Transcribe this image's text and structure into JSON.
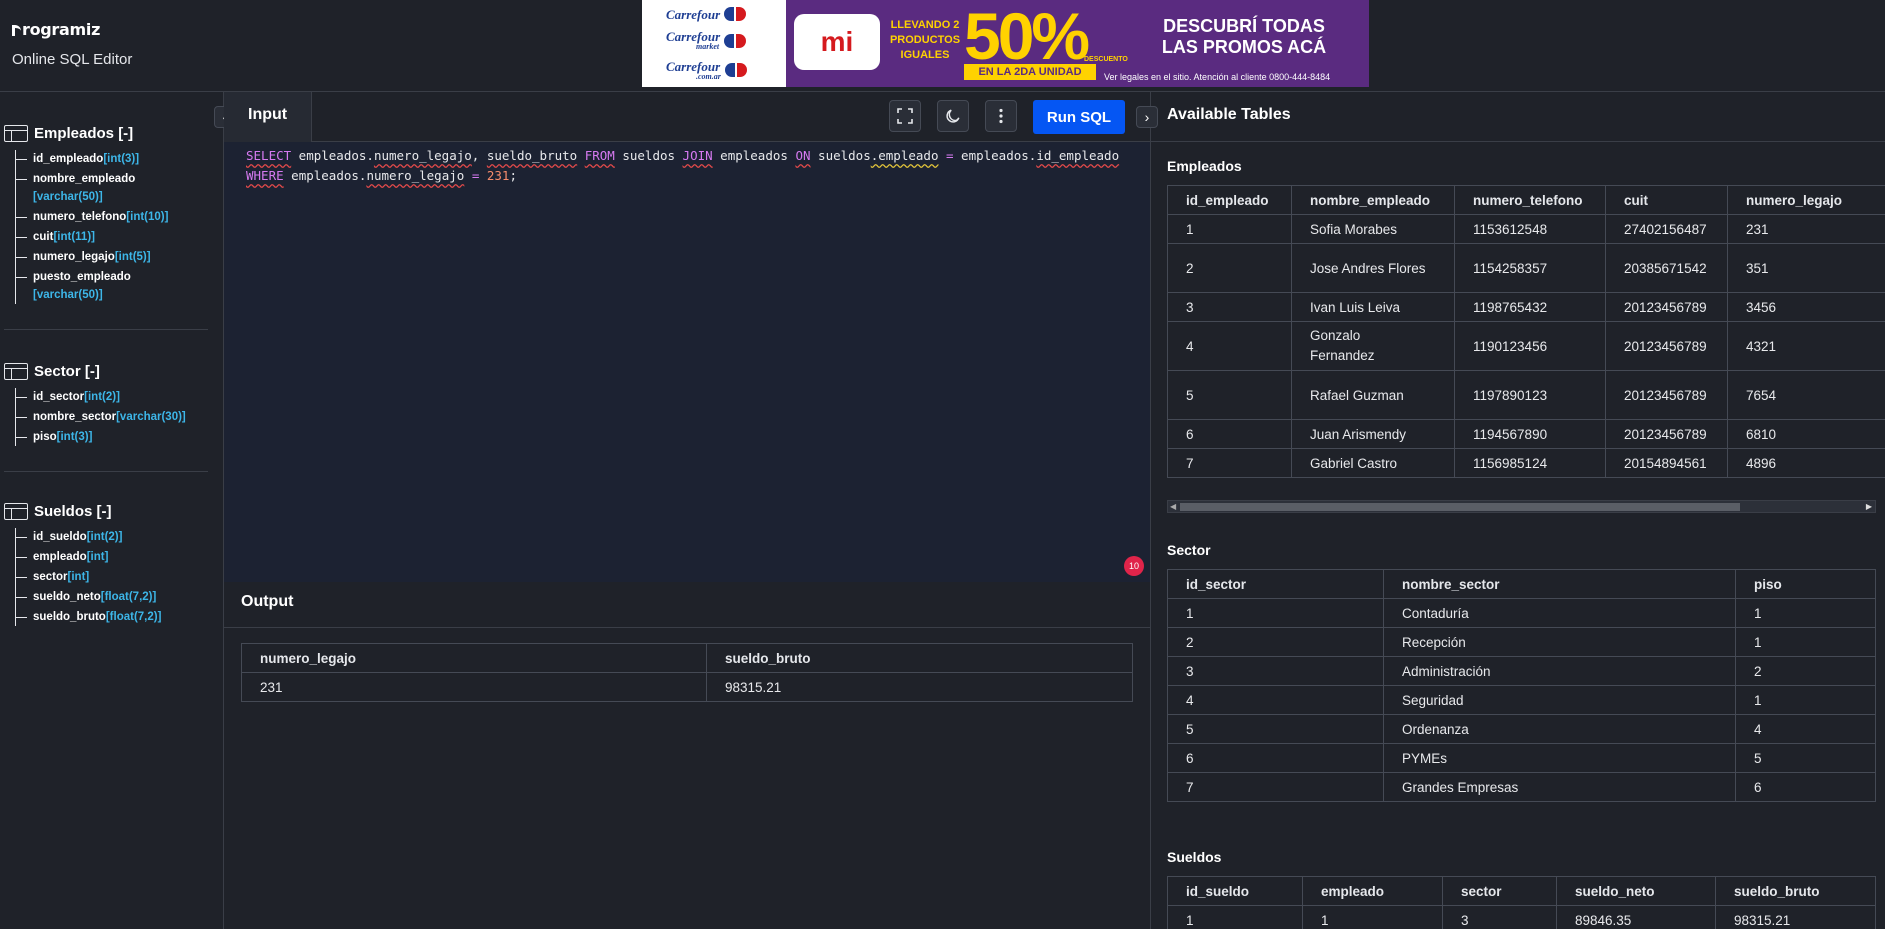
{
  "header": {
    "logo": "rogramiz",
    "subtitle": "Online SQL Editor"
  },
  "ad": {
    "brand1": "Carrefour",
    "brand2": "Carrefour",
    "brand2_sub": "market",
    "brand3": "Carrefour",
    "brand3_sub": ".com.ar",
    "mi": "mi",
    "llevando": "LLEVANDO 2 PRODUCTOS IGUALES",
    "pct": "50%",
    "descuento": "DESCUENTO",
    "unidad": "EN LA 2DA UNIDAD",
    "headline": "DESCUBRÍ TODAS LAS PROMOS ACÁ",
    "legal": "Ver legales en el sitio. Atención al cliente 0800-444-8484"
  },
  "sidebar": {
    "tables": [
      {
        "title": "Empleados [-]",
        "columns": [
          {
            "name": "id_empleado",
            "type": "[int(3)]"
          },
          {
            "name": "nombre_empleado",
            "type": "[varchar(50)]"
          },
          {
            "name": "numero_telefono",
            "type": "[int(10)]"
          },
          {
            "name": "cuit",
            "type": "[int(11)]"
          },
          {
            "name": "numero_legajo",
            "type": "[int(5)]"
          },
          {
            "name": "puesto_empleado",
            "type": "[varchar(50)]"
          }
        ]
      },
      {
        "title": "Sector [-]",
        "columns": [
          {
            "name": "id_sector",
            "type": "[int(2)]"
          },
          {
            "name": "nombre_sector",
            "type": "[varchar(30)]"
          },
          {
            "name": "piso",
            "type": "[int(3)]"
          }
        ]
      },
      {
        "title": "Sueldos [-]",
        "columns": [
          {
            "name": "id_sueldo",
            "type": "[int(2)]"
          },
          {
            "name": "empleado",
            "type": "[int]"
          },
          {
            "name": "sector",
            "type": "[int]"
          },
          {
            "name": "sueldo_neto",
            "type": "[float(7,2)]"
          },
          {
            "name": "sueldo_bruto",
            "type": "[float(7,2)]"
          }
        ]
      }
    ]
  },
  "editor": {
    "tab_label": "Input",
    "run_label": "Run SQL",
    "problems_count": "10",
    "line1": {
      "t1": "SELECT",
      "t2": " empleados.",
      "t3": "numero_legajo",
      "t4": ", ",
      "t5": "sueldo_bruto",
      "t6": " ",
      "t7": "FROM",
      "t8": " sueldos ",
      "t9": "JOIN",
      "t10": " empleados ",
      "t11": "ON",
      "t12": " sueldos",
      "t13": ".empleado",
      "t14": " ",
      "t15": "=",
      "t16": " empleados.",
      "t17": "id_empleado"
    },
    "line2": {
      "t1": "WHERE",
      "t2": " empleados.",
      "t3": "numero_legajo",
      "t4": " ",
      "t5": "=",
      "t6": " ",
      "t7": "231",
      "t8": ";"
    }
  },
  "output": {
    "title": "Output",
    "headers": [
      "numero_legajo",
      "sueldo_bruto"
    ],
    "rows": [
      [
        "231",
        "98315.21"
      ]
    ]
  },
  "right": {
    "title": "Available Tables",
    "empleados": {
      "title": "Empleados",
      "headers": [
        "id_empleado",
        "nombre_empleado",
        "numero_telefono",
        "cuit",
        "numero_legajo"
      ],
      "rows": [
        [
          "1",
          "Sofia Morabes",
          "1153612548",
          "27402156487",
          "231"
        ],
        [
          "2",
          "Jose Andres Flores",
          "1154258357",
          "20385671542",
          "351"
        ],
        [
          "3",
          "Ivan Luis Leiva",
          "1198765432",
          "20123456789",
          "3456"
        ],
        [
          "4",
          "Gonzalo Fernandez",
          "1190123456",
          "20123456789",
          "4321"
        ],
        [
          "5",
          "Rafael Guzman",
          "1197890123",
          "20123456789",
          "7654"
        ],
        [
          "6",
          "Juan Arismendy",
          "1194567890",
          "20123456789",
          "6810"
        ],
        [
          "7",
          "Gabriel Castro",
          "1156985124",
          "20154894561",
          "4896"
        ]
      ]
    },
    "sector": {
      "title": "Sector",
      "headers": [
        "id_sector",
        "nombre_sector",
        "piso"
      ],
      "rows": [
        [
          "1",
          "Contaduría",
          "1"
        ],
        [
          "2",
          "Recepción",
          "1"
        ],
        [
          "3",
          "Administración",
          "2"
        ],
        [
          "4",
          "Seguridad",
          "1"
        ],
        [
          "5",
          "Ordenanza",
          "4"
        ],
        [
          "6",
          "PYMEs",
          "5"
        ],
        [
          "7",
          "Grandes Empresas",
          "6"
        ]
      ]
    },
    "sueldos": {
      "title": "Sueldos",
      "headers": [
        "id_sueldo",
        "empleado",
        "sector",
        "sueldo_neto",
        "sueldo_bruto"
      ],
      "rows": [
        [
          "1",
          "1",
          "3",
          "89846.35",
          "98315.21"
        ]
      ]
    }
  }
}
